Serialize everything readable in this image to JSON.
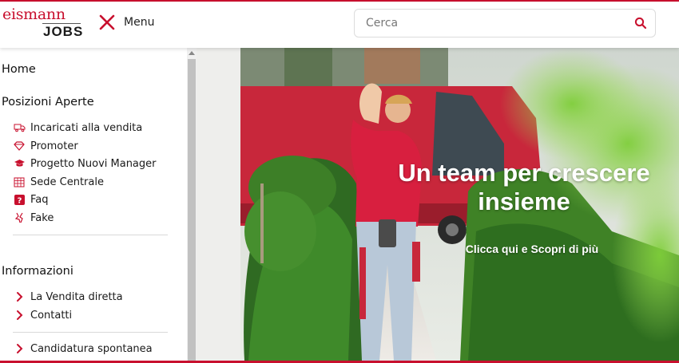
{
  "brand": {
    "logo_top": "eismann",
    "logo_bottom": "JOBS",
    "accent_color": "#c8102e"
  },
  "header": {
    "menu_label": "Menu",
    "menu_icon": "close-x-icon",
    "search": {
      "placeholder": "Cerca",
      "value": "",
      "icon": "search-icon"
    }
  },
  "sidebar": {
    "home_label": "Home",
    "open_positions": {
      "title": "Posizioni Aperte",
      "items": [
        {
          "label": "Incaricati alla vendita",
          "icon": "truck-icon"
        },
        {
          "label": "Promoter",
          "icon": "gem-icon"
        },
        {
          "label": "Progetto Nuovi Manager",
          "icon": "graduation-cap-icon"
        },
        {
          "label": "Sede Centrale",
          "icon": "building-icon"
        },
        {
          "label": "Faq",
          "icon": "question-icon"
        },
        {
          "label": "Fake",
          "icon": "fake-icon"
        }
      ]
    },
    "info": {
      "title": "Informazioni",
      "items": [
        {
          "label": "La Vendita diretta",
          "icon": "chevron-right-icon"
        },
        {
          "label": "Contatti",
          "icon": "chevron-right-icon"
        }
      ]
    },
    "spontaneous": {
      "label": "Candidatura spontanea",
      "icon": "chevron-right-icon"
    }
  },
  "hero": {
    "title": "Un team per crescere insieme",
    "cta": "Clicca qui e Scopri di più"
  }
}
